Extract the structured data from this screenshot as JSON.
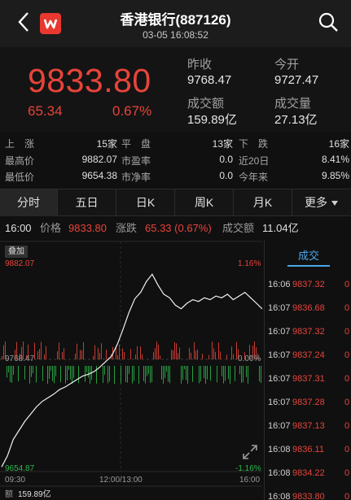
{
  "header": {
    "title": "香港银行(887126)",
    "timestamp": "03-05 16:08:52"
  },
  "quote": {
    "price": "9833.80",
    "change": "65.34",
    "change_pct": "0.67%",
    "prev_close_label": "昨收",
    "prev_close": "9768.47",
    "open_label": "今开",
    "open": "9727.47",
    "turnover_label": "成交额",
    "turnover": "159.89亿",
    "volume_label": "成交量",
    "volume": "27.13亿"
  },
  "stats": {
    "up_label": "上　涨",
    "up_value": "15家",
    "flat_label": "平　盘",
    "flat_value": "13家",
    "down_label": "下　跌",
    "down_value": "16家",
    "high_label": "最高价",
    "high_value": "9882.07",
    "pe_label": "市盈率",
    "pe_value": "0.0",
    "d20_label": "近20日",
    "d20_value": "8.41%",
    "low_label": "最低价",
    "low_value": "9654.38",
    "pb_label": "市净率",
    "pb_value": "0.0",
    "ytd_label": "今年来",
    "ytd_value": "9.85%"
  },
  "tabs": [
    "分时",
    "五日",
    "日K",
    "周K",
    "月K",
    "更多"
  ],
  "info": {
    "time": "16:00",
    "price_label": "价格",
    "price_value": "9833.80",
    "chg_label": "涨跌",
    "chg_value": "65.33 (0.67%)",
    "amt_label": "成交额",
    "amt_value": "11.04亿"
  },
  "chart": {
    "badge": "叠加",
    "y_high": "9882.07",
    "y_high_pct": "1.16%",
    "y_mid": "9768.47",
    "y_mid_pct": "0.00%",
    "y_low": "9654.87",
    "y_low_pct": "-1.16%",
    "x_start": "09:30",
    "x_mid": "12:00/13:00",
    "x_end": "16:00",
    "volume_label": "额",
    "volume_value": "159.89亿"
  },
  "chart_data": {
    "type": "line",
    "series": [
      {
        "values": [
          9660,
          9672,
          9690,
          9700,
          9710,
          9718,
          9726,
          9732,
          9736,
          9740,
          9745,
          9748,
          9752,
          9756,
          9760,
          9762,
          9765,
          9770,
          9776,
          9782,
          9795,
          9812,
          9830,
          9845,
          9852,
          9864,
          9872,
          9860,
          9850,
          9846,
          9838,
          9834,
          9840,
          9844,
          9842,
          9846,
          9844,
          9848,
          9846,
          9850,
          9844,
          9848,
          9852,
          9846,
          9840,
          9833.8
        ]
      }
    ],
    "ylim": [
      9654.87,
      9882.07
    ],
    "colors": {
      "up": "#e8443a",
      "down": "#2db84a",
      "line": "#f2f2f2"
    }
  },
  "trades": {
    "tab_label": "成交",
    "rows": [
      {
        "time": "16:06",
        "price": "9837.32",
        "vol": "0"
      },
      {
        "time": "16:07",
        "price": "9836.68",
        "vol": "0"
      },
      {
        "time": "16:07",
        "price": "9837.32",
        "vol": "0"
      },
      {
        "time": "16:07",
        "price": "9837.24",
        "vol": "0"
      },
      {
        "time": "16:07",
        "price": "9837.31",
        "vol": "0"
      },
      {
        "time": "16:07",
        "price": "9837.28",
        "vol": "0"
      },
      {
        "time": "16:07",
        "price": "9837.13",
        "vol": "0"
      },
      {
        "time": "16:08",
        "price": "9836.11",
        "vol": "0"
      },
      {
        "time": "16:08",
        "price": "9834.22",
        "vol": "0"
      },
      {
        "time": "16:08",
        "price": "9833.80",
        "vol": "0"
      }
    ]
  }
}
